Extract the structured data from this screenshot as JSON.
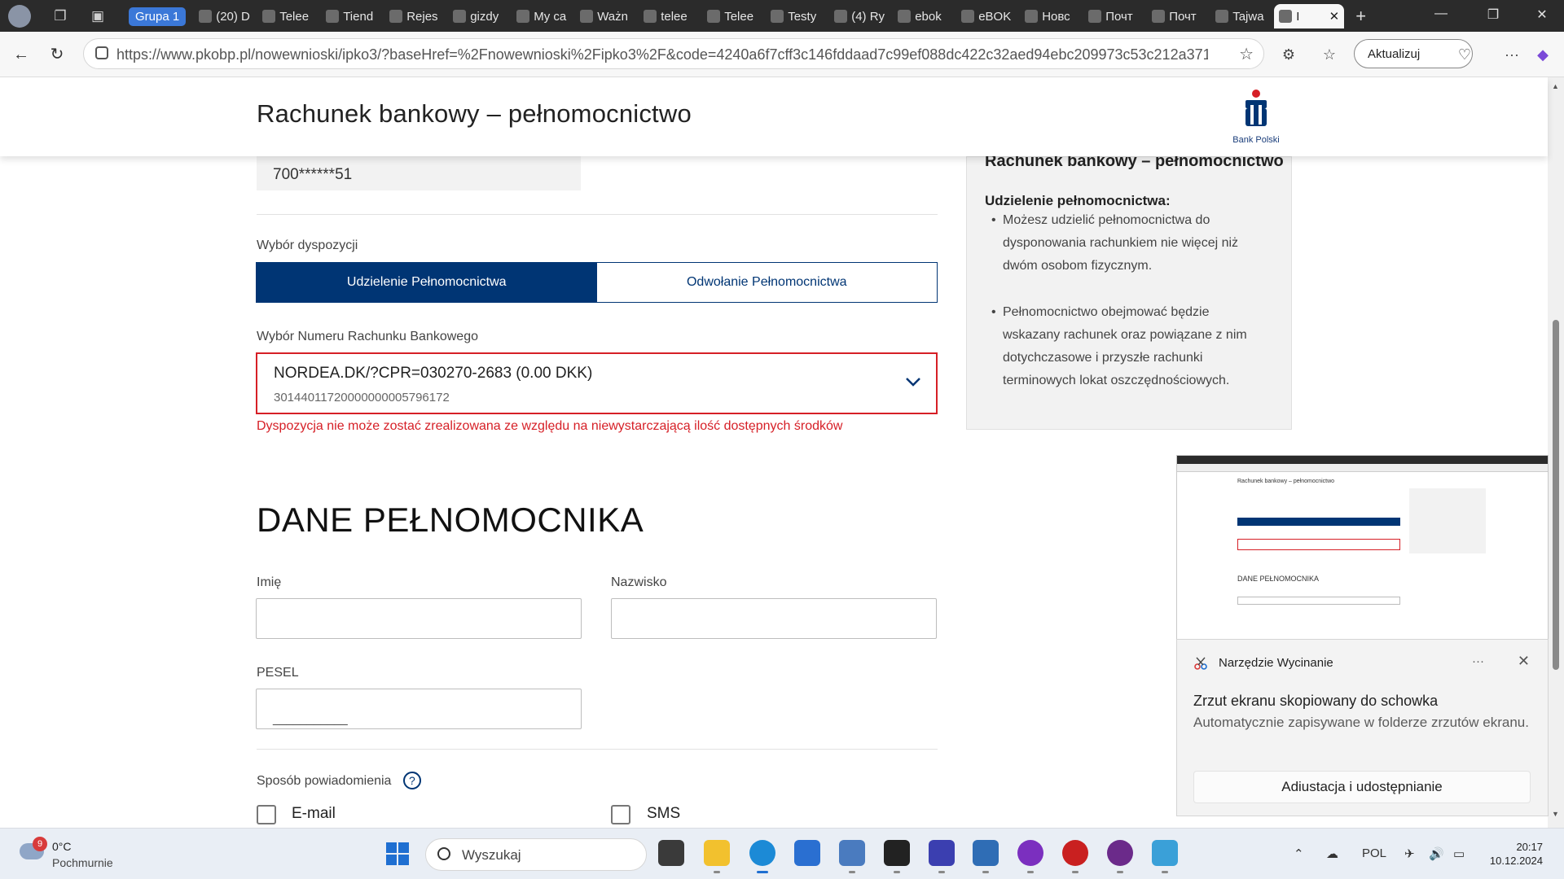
{
  "browser": {
    "group_label": "Grupa 1",
    "tabs": [
      "(20) D",
      "Telee",
      "Tiend",
      "Rejes",
      "gizdy",
      "My ca",
      "Ważn",
      "telee",
      "Telee",
      "Testy",
      "(4) Ry",
      "ebok",
      "eBOK",
      "Новс",
      "Почт",
      "Почт",
      "Tajwa",
      "I"
    ],
    "url": "https://www.pkobp.pl/nowewnioski/ipko3/?baseHref=%2Fnowewnioski%2Fipko3%2F&code=4240a6f7cff3c146fddaad7c99ef088dc422c32aed94ebc209973c53c212a371&form...",
    "update_label": "Aktualizuj"
  },
  "page": {
    "title": "Rachunek bankowy – pełnomocnictwo",
    "brand": "Bank Polski",
    "masked_account": "700******51",
    "disposition_label": "Wybór dyspozycji",
    "tab_grant": "Udzielenie Pełnomocnictwa",
    "tab_revoke": "Odwołanie Pełnomocnictwa",
    "account_label": "Wybór Numeru Rachunku Bankowego",
    "account_name": "NORDEA.DK/?CPR=030270-2683 (0.00 DKK)",
    "account_number": "30144011720000000005796172",
    "error": "Dyspozycja nie może zostać zrealizowana ze względu na niewystarczającą ilość dostępnych środków",
    "section_title": "DANE PEŁNOMOCNIKA",
    "first_name_label": "Imię",
    "last_name_label": "Nazwisko",
    "pesel_label": "PESEL",
    "pesel_mask": "___________",
    "notify_label": "Sposób powiadomienia",
    "notify_help": "?",
    "opt_email": "E-mail",
    "opt_sms": "SMS"
  },
  "info": {
    "title": "Rachunek bankowy – pełnomocnictwo",
    "subtitle": "Udzielenie pełnomocnictwa:",
    "item1": "Możesz udzielić pełnomocnictwa do dysponowania rachunkiem nie więcej niż dwóm osobom fizycznym.",
    "item2": "Pełnomocnictwo obejmować będzie wskazany rachunek oraz powiązane z nim dotychczasowe i przyszłe rachunki terminowych lokat oszczędnościowych."
  },
  "snip_preview": {
    "title": "Rachunek bankowy – pełnomocnictwo",
    "section": "DANE PEŁNOMOCNIKA"
  },
  "toast": {
    "app_name": "Narzędzie Wycinanie",
    "more": "···",
    "close": "✕",
    "headline": "Zrzut ekranu skopiowany do schowka",
    "body": "Automatycznie zapisywane w folderze zrzutów ekranu.",
    "action": "Adiustacja i udostępnianie"
  },
  "taskbar": {
    "weather_badge": "9",
    "temp": "0°C",
    "weather": "Pochmurnie",
    "search": "Wyszukaj",
    "lang": "POL",
    "time": "20:17",
    "date": "10.12.2024"
  },
  "colors": {
    "pko_navy": "#003574",
    "error_red": "#d61f26",
    "windows_blue": "#1f6fd1"
  }
}
